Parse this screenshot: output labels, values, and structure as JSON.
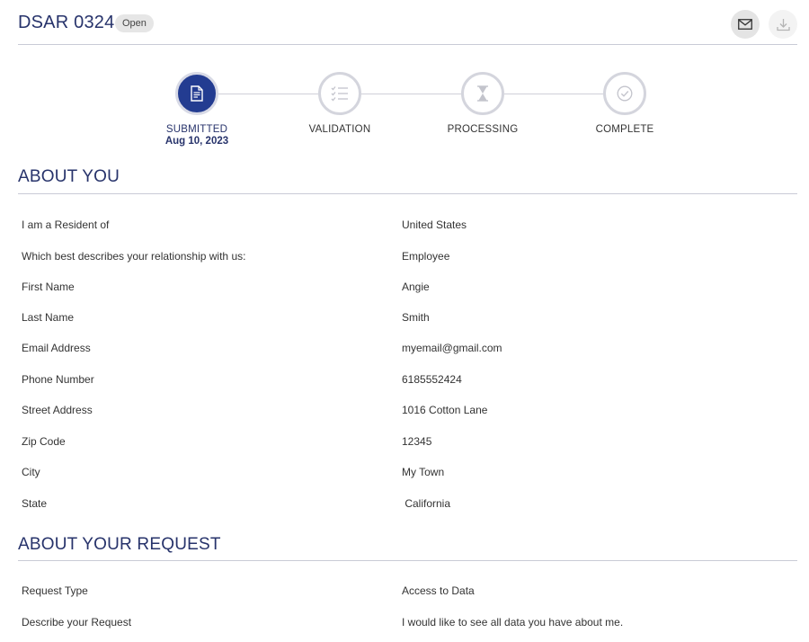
{
  "header": {
    "title": "DSAR 0324",
    "status": "Open",
    "mail_icon": "mail-icon",
    "download_icon": "download-icon"
  },
  "stepper": {
    "steps": [
      {
        "label": "SUBMITTED",
        "date": "Aug 10, 2023",
        "icon": "document-icon",
        "active": true
      },
      {
        "label": "VALIDATION",
        "icon": "checklist-icon",
        "active": false
      },
      {
        "label": "PROCESSING",
        "icon": "hourglass-icon",
        "active": false
      },
      {
        "label": "COMPLETE",
        "icon": "check-circle-icon",
        "active": false
      }
    ]
  },
  "about_you": {
    "title": "ABOUT YOU",
    "fields": [
      {
        "label": "I am a Resident of",
        "value": "United States"
      },
      {
        "label": "Which best describes your relationship with us:",
        "value": "Employee"
      },
      {
        "label": "First Name",
        "value": "Angie"
      },
      {
        "label": "Last Name",
        "value": "Smith"
      },
      {
        "label": "Email Address",
        "value": "myemail@gmail.com"
      },
      {
        "label": "Phone Number",
        "value": "6185552424"
      },
      {
        "label": "Street Address",
        "value": "1016 Cotton Lane"
      },
      {
        "label": "Zip Code",
        "value": "12345"
      },
      {
        "label": "City",
        "value": "My Town"
      },
      {
        "label": "State",
        "value": " California"
      }
    ]
  },
  "about_request": {
    "title": "ABOUT YOUR REQUEST",
    "fields": [
      {
        "label": "Request Type",
        "value": "Access to Data"
      },
      {
        "label": "Describe your Request",
        "value": "I would like to see all data you have about me."
      }
    ]
  },
  "colors": {
    "accent": "#27336b",
    "active_step": "#233c91",
    "rule": "#c9cbd6"
  }
}
